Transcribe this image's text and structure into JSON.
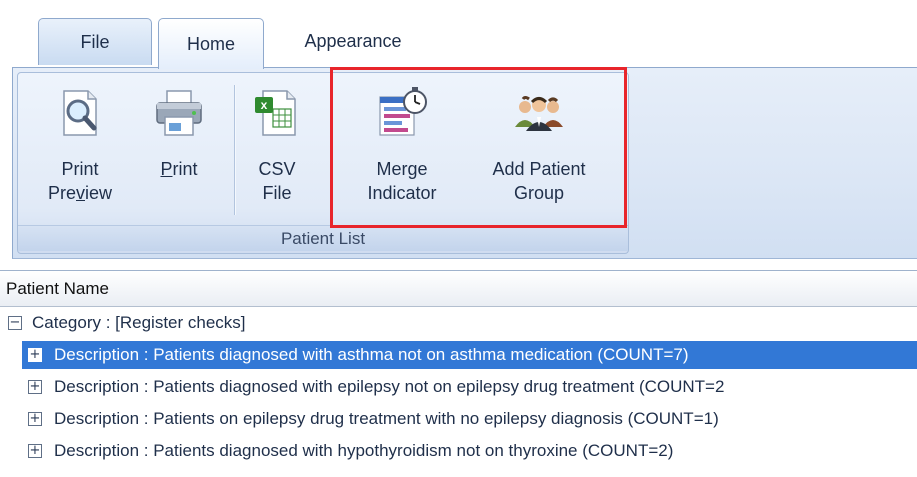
{
  "tabs": {
    "file": "File",
    "home": "Home",
    "appearance": "Appearance"
  },
  "ribbon": {
    "group_caption": "Patient List",
    "buttons": {
      "print_preview": {
        "line1": "Print",
        "line2_pre": "Pre",
        "line2_u": "v",
        "line2_post": "iew",
        "icon": "print-preview-icon"
      },
      "print": {
        "u": "P",
        "rest": "rint",
        "icon": "printer-icon"
      },
      "csv": {
        "line1": "CSV",
        "line2": "File",
        "icon": "excel-csv-icon"
      },
      "merge": {
        "line1": "Merge",
        "line2": "Indicator",
        "icon": "merge-indicator-icon"
      },
      "add_group": {
        "line1": "Add Patient",
        "line2": "Group",
        "icon": "patient-group-icon"
      }
    }
  },
  "grid": {
    "column_header": "Patient Name",
    "category": "Category : [Register checks]",
    "rows": [
      "Description : Patients diagnosed with asthma not on asthma medication (COUNT=7)",
      "Description : Patients diagnosed with epilepsy not on epilepsy drug treatment (COUNT=2",
      "Description : Patients on epilepsy drug treatment with no epilepsy diagnosis (COUNT=1)",
      "Description : Patients diagnosed with hypothyroidism not on thyroxine (COUNT=2)"
    ]
  },
  "colors": {
    "highlight_border": "#e8252b",
    "selection": "#3278d6"
  }
}
